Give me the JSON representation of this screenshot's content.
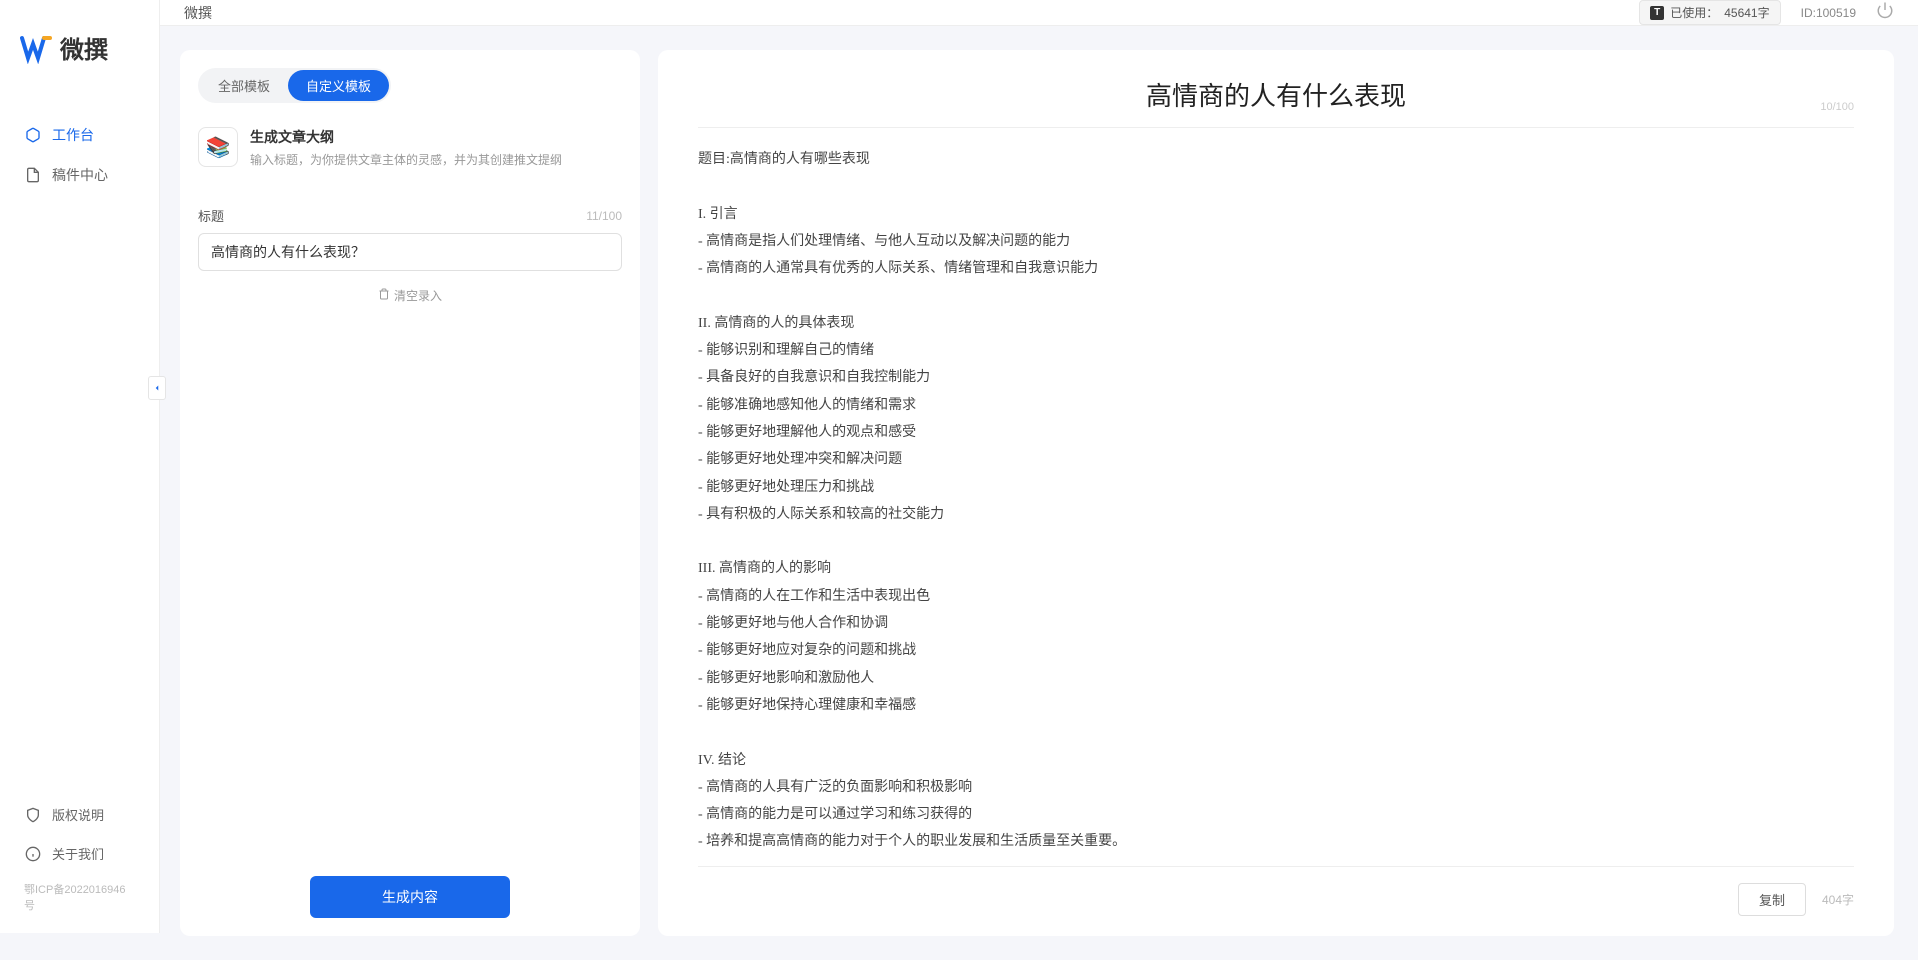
{
  "app": {
    "name": "微撰",
    "breadcrumb": "微撰"
  },
  "sidebar": {
    "items": [
      {
        "label": "工作台"
      },
      {
        "label": "稿件中心"
      }
    ],
    "bottom": [
      {
        "label": "版权说明"
      },
      {
        "label": "关于我们"
      }
    ],
    "icp": "鄂ICP备2022016946号"
  },
  "topbar": {
    "usage_prefix": "已使用：",
    "usage_value": "45641字",
    "id_text": "ID:100519"
  },
  "left": {
    "tabs": [
      {
        "label": "全部模板"
      },
      {
        "label": "自定义模板"
      }
    ],
    "template": {
      "title": "生成文章大纲",
      "desc": "输入标题，为你提供文章主体的灵感，并为其创建推文提纲"
    },
    "field_label": "标题",
    "field_counter": "11/100",
    "title_value": "高情商的人有什么表现？",
    "clear_label": "清空录入",
    "generate_label": "生成内容"
  },
  "right": {
    "title": "高情商的人有什么表现",
    "title_counter": "10/100",
    "body": "题目:高情商的人有哪些表现\n\nI. 引言\n- 高情商是指人们处理情绪、与他人互动以及解决问题的能力\n- 高情商的人通常具有优秀的人际关系、情绪管理和自我意识能力\n\nII. 高情商的人的具体表现\n- 能够识别和理解自己的情绪\n- 具备良好的自我意识和自我控制能力\n- 能够准确地感知他人的情绪和需求\n- 能够更好地理解他人的观点和感受\n- 能够更好地处理冲突和解决问题\n- 能够更好地处理压力和挑战\n- 具有积极的人际关系和较高的社交能力\n\nIII. 高情商的人的影响\n- 高情商的人在工作和生活中表现出色\n- 能够更好地与他人合作和协调\n- 能够更好地应对复杂的问题和挑战\n- 能够更好地影响和激励他人\n- 能够更好地保持心理健康和幸福感\n\nIV. 结论\n- 高情商的人具有广泛的负面影响和积极影响\n- 高情商的能力是可以通过学习和练习获得的\n- 培养和提高高情商的能力对于个人的职业发展和生活质量至关重要。",
    "copy_label": "复制",
    "word_count": "404字"
  }
}
